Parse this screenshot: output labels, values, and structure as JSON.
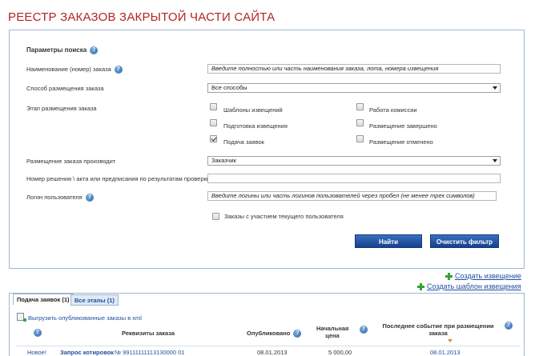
{
  "page": {
    "title": "РЕЕСТР ЗАКАЗОВ ЗАКРЫТОЙ ЧАСТИ САЙТА"
  },
  "search": {
    "heading": "Параметры поиска",
    "name_label": "Наименование (номер) заказа",
    "name_value": "Введите полностью или часть наименования заказа, лота, номера извещения",
    "method_label": "Способ размещения заказа",
    "method_value": "Все способы",
    "stage_label": "Этап размещения заказа",
    "stages": [
      {
        "label": "Шаблоны извещений",
        "checked": false
      },
      {
        "label": "Подготовка извещения",
        "checked": false
      },
      {
        "label": "Подача заявок",
        "checked": true
      },
      {
        "label": "Работа комиссии",
        "checked": false
      },
      {
        "label": "Размещение завершено",
        "checked": false
      },
      {
        "label": "Размещение отменено",
        "checked": false
      }
    ],
    "producer_label": "Размещение заказа производит",
    "producer_value": "Заказчик",
    "decision_label": "Номер решения \\ акта или предписания по результатам проверки",
    "decision_value": "",
    "login_label": "Логин пользователя",
    "login_value": "Введите логины или часть логинов пользователей через пробел (не менее трех символов)",
    "participation_label": "Заказы с участием текущего пользователя",
    "find_button": "Найти",
    "clear_button": "Очистить фильтр"
  },
  "actions": {
    "create_notice": "Создать извещение",
    "create_template": "Создать шаблон извещения"
  },
  "results": {
    "tabs": [
      {
        "label": "Подача заявок (1)",
        "active": true
      },
      {
        "label": "Все этапы (1)",
        "active": false
      }
    ],
    "export_label": "Выгрузить опубликованные заказы в xml",
    "columns": {
      "details": "Реквизиты заказа",
      "published": "Опубликовано",
      "price_line1": "Начальная",
      "price_line2": "цена",
      "event_line1": "Последнее событие при размещении",
      "event_line2": "заказа"
    },
    "rows": [
      {
        "status": "Новое!",
        "details": "Запрос котировок",
        "number": "№  99111111113130000 01",
        "published": "08.01.2013",
        "price": "5 000,00",
        "event": "08.01.2013"
      }
    ]
  },
  "colors": {
    "title": "#b32424",
    "accent": "#1f4fa0",
    "button": "#16408a",
    "border": "#9fb7cf",
    "plus": "#3aa232",
    "sort_arrow": "#f08a24"
  }
}
